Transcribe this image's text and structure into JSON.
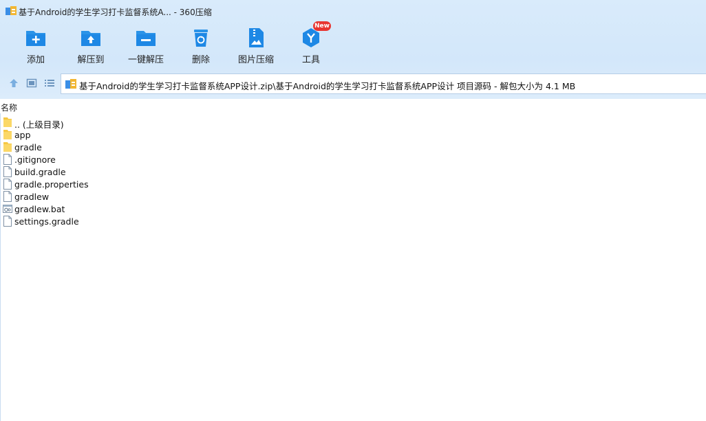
{
  "window": {
    "title": "基于Android的学生学习打卡监督系统A... - 360压缩"
  },
  "toolbar": {
    "buttons": [
      {
        "label": "添加",
        "icon": "add-folder-icon"
      },
      {
        "label": "解压到",
        "icon": "extract-to-icon"
      },
      {
        "label": "一键解压",
        "icon": "one-click-extract-icon"
      },
      {
        "label": "删除",
        "icon": "recycle-bin-icon"
      },
      {
        "label": "图片压缩",
        "icon": "image-compress-icon"
      },
      {
        "label": "工具",
        "icon": "tools-icon",
        "badge": "New"
      }
    ]
  },
  "nav": {
    "up_icon": "up-arrow-icon",
    "thumbnail_icon": "thumbnail-view-icon",
    "list_icon": "list-view-icon"
  },
  "address": {
    "path": "基于Android的学生学习打卡监督系统APP设计.zip\\基于Android的学生学习打卡监督系统APP设计 项目源码 - 解包大小为 4.1 MB"
  },
  "columns": {
    "name": "名称"
  },
  "files": [
    {
      "name": ".. (上级目录)",
      "type": "folder"
    },
    {
      "name": "app",
      "type": "folder"
    },
    {
      "name": "gradle",
      "type": "folder"
    },
    {
      "name": ".gitignore",
      "type": "file"
    },
    {
      "name": "build.gradle",
      "type": "file"
    },
    {
      "name": "gradle.properties",
      "type": "file"
    },
    {
      "name": "gradlew",
      "type": "file"
    },
    {
      "name": "gradlew.bat",
      "type": "bat"
    },
    {
      "name": "settings.gradle",
      "type": "file"
    }
  ],
  "colors": {
    "accent": "#1e8fe6",
    "folder": "#f6c844",
    "badge": "#e8342f",
    "toolbar_bg": "#d6e9fa"
  }
}
